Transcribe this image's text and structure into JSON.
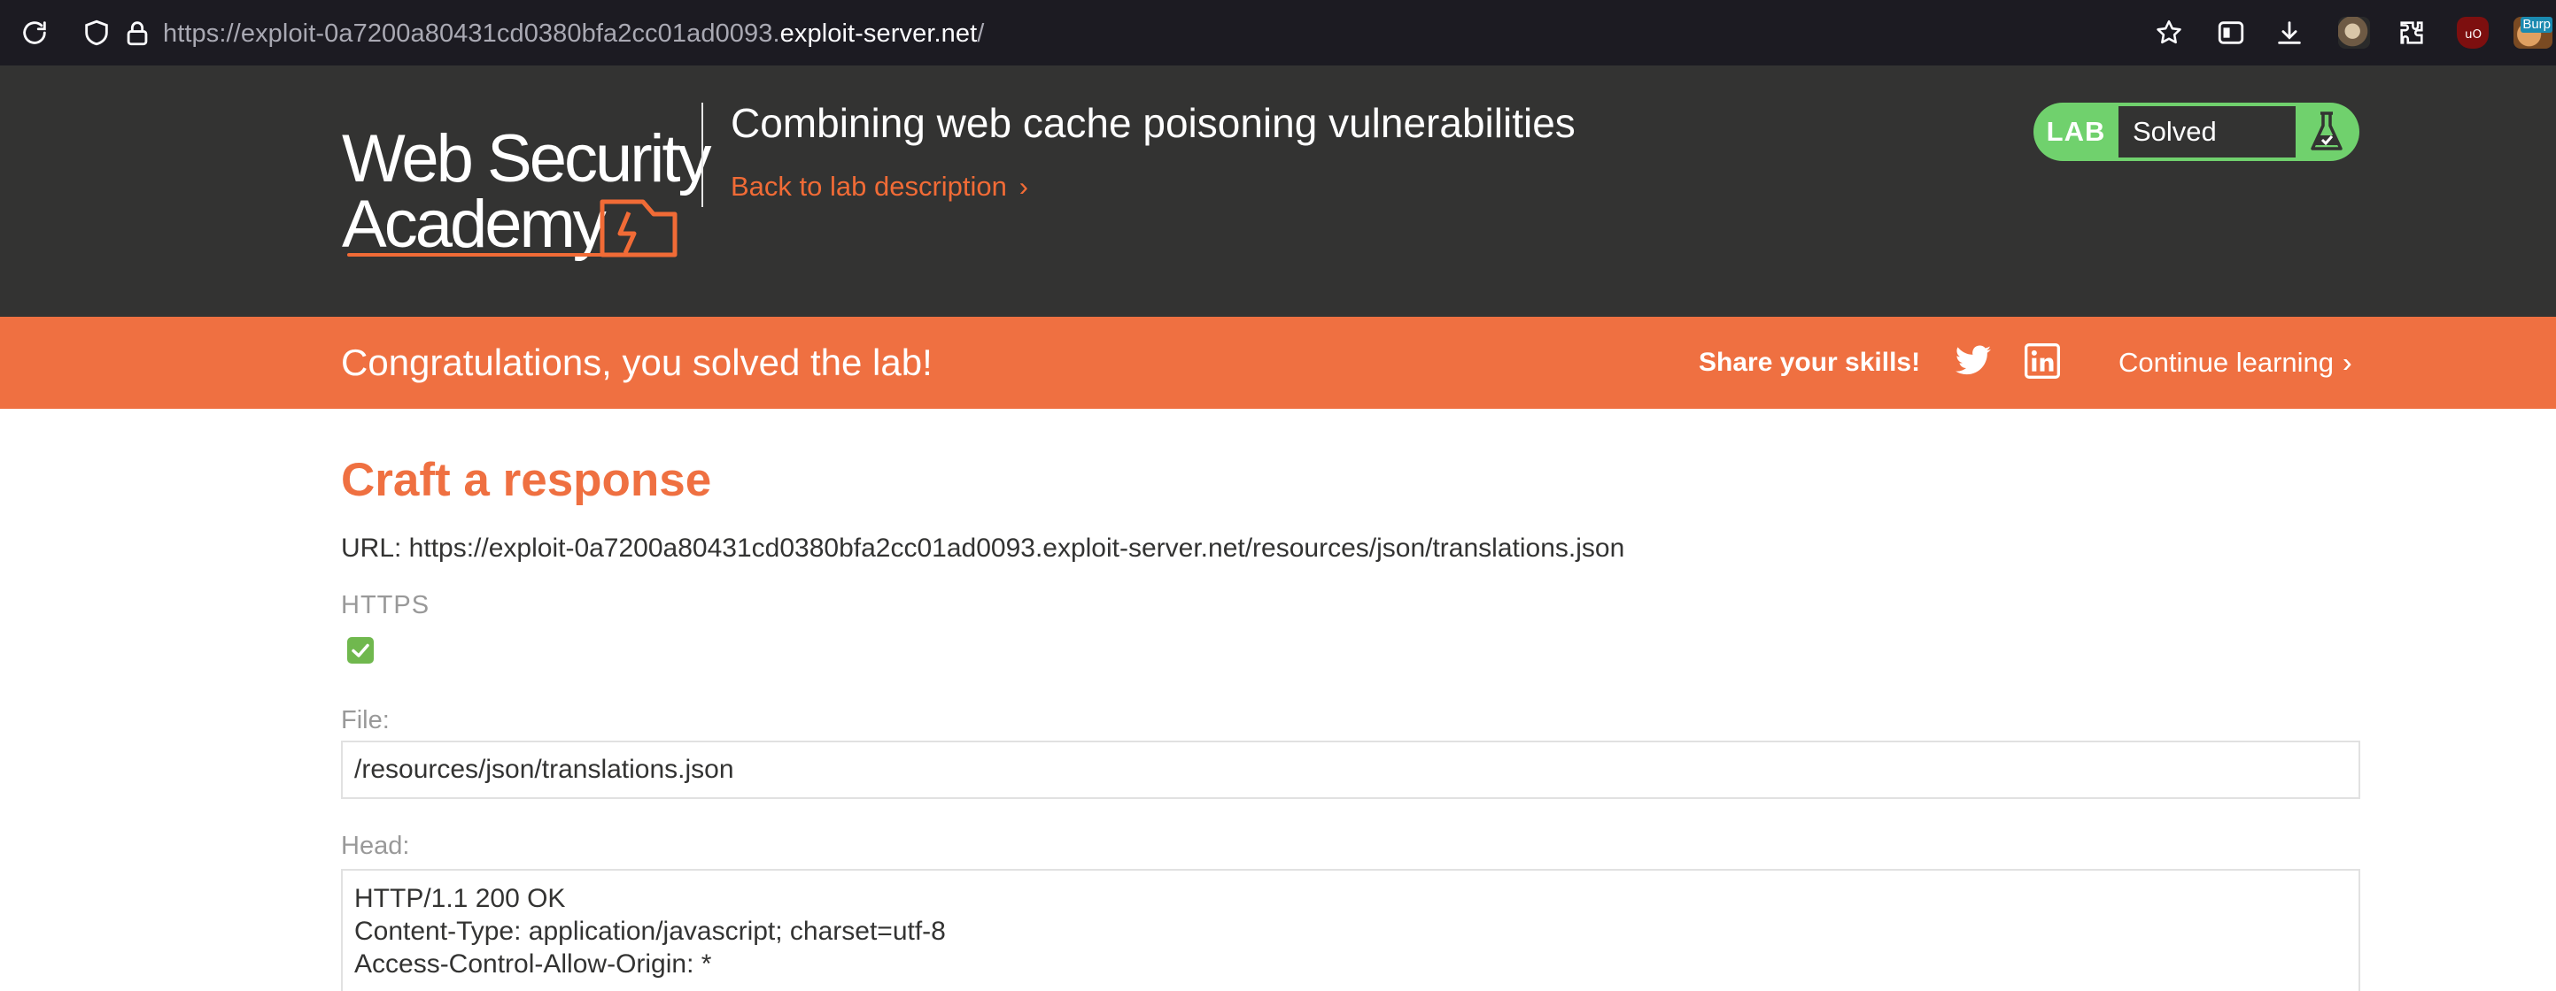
{
  "browser": {
    "url_prefix": "https://exploit-0a7200a80431cd0380bfa2cc01ad0093.",
    "url_host": "exploit-server.net",
    "url_suffix": "/",
    "extension_text": "Burp"
  },
  "header": {
    "logo_line1": "Web Security",
    "logo_line2": "Academy",
    "lab_title": "Combining web cache poisoning vulnerabilities",
    "back_link": "Back to lab description",
    "status_badge": "LAB",
    "status_text": "Solved"
  },
  "banner": {
    "message": "Congratulations, you solved the lab!",
    "share_label": "Share your skills!",
    "continue_label": "Continue learning"
  },
  "main": {
    "heading": "Craft a response",
    "url_line": "URL: https://exploit-0a7200a80431cd0380bfa2cc01ad0093.exploit-server.net/resources/json/translations.json",
    "https_label": "HTTPS",
    "https_checked": true,
    "file_label": "File:",
    "file_value": "/resources/json/translations.json",
    "head_label": "Head:",
    "head_lines": [
      "HTTP/1.1 200 OK",
      "Content-Type: application/javascript; charset=utf-8",
      "Access-Control-Allow-Origin: *"
    ]
  },
  "colors": {
    "accent": "#ef7041",
    "header_bg": "#333332",
    "lab_green": "#70d16d",
    "browser_bg": "#1c1b22"
  }
}
